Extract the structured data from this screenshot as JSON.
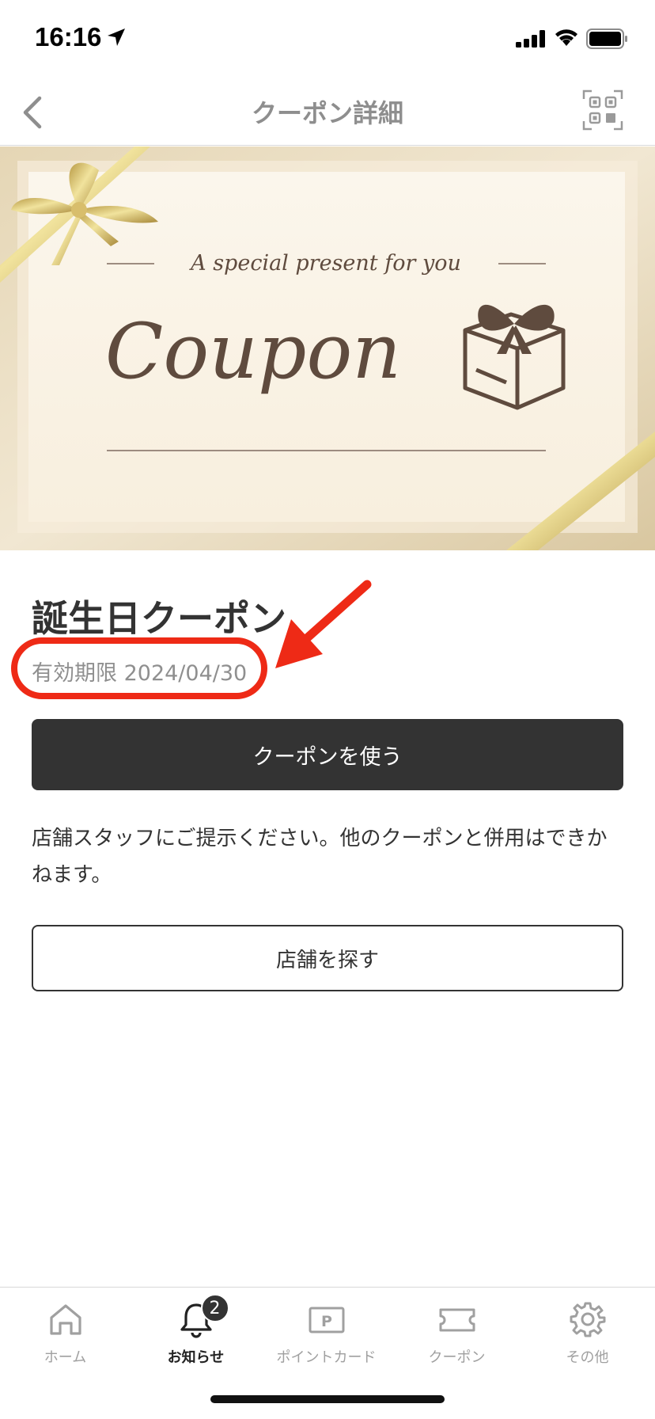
{
  "status_bar": {
    "time": "16:16"
  },
  "nav": {
    "title": "クーポン詳細"
  },
  "banner": {
    "subtitle": "A special present for you",
    "title": "Coupon"
  },
  "coupon": {
    "title": "誕生日クーポン",
    "expiry_label": "有効期限",
    "expiry_date": "2024/04/30",
    "use_button": "クーポンを使う",
    "description": "店舗スタッフにご提示ください。他のクーポンと併用はできかねます。",
    "store_button": "店舗を探す"
  },
  "tabs": [
    {
      "label": "ホーム",
      "icon": "home-icon",
      "active": false
    },
    {
      "label": "お知らせ",
      "icon": "bell-icon",
      "active": true,
      "badge": "2"
    },
    {
      "label": "ポイントカード",
      "icon": "point-card-icon",
      "active": false
    },
    {
      "label": "クーポン",
      "icon": "ticket-icon",
      "active": false
    },
    {
      "label": "その他",
      "icon": "gear-icon",
      "active": false
    }
  ],
  "colors": {
    "accent_dark": "#333333",
    "annotation_red": "#ee2a16",
    "banner_brown": "#5f4b3e",
    "ribbon_gold": "#c8a94e"
  }
}
